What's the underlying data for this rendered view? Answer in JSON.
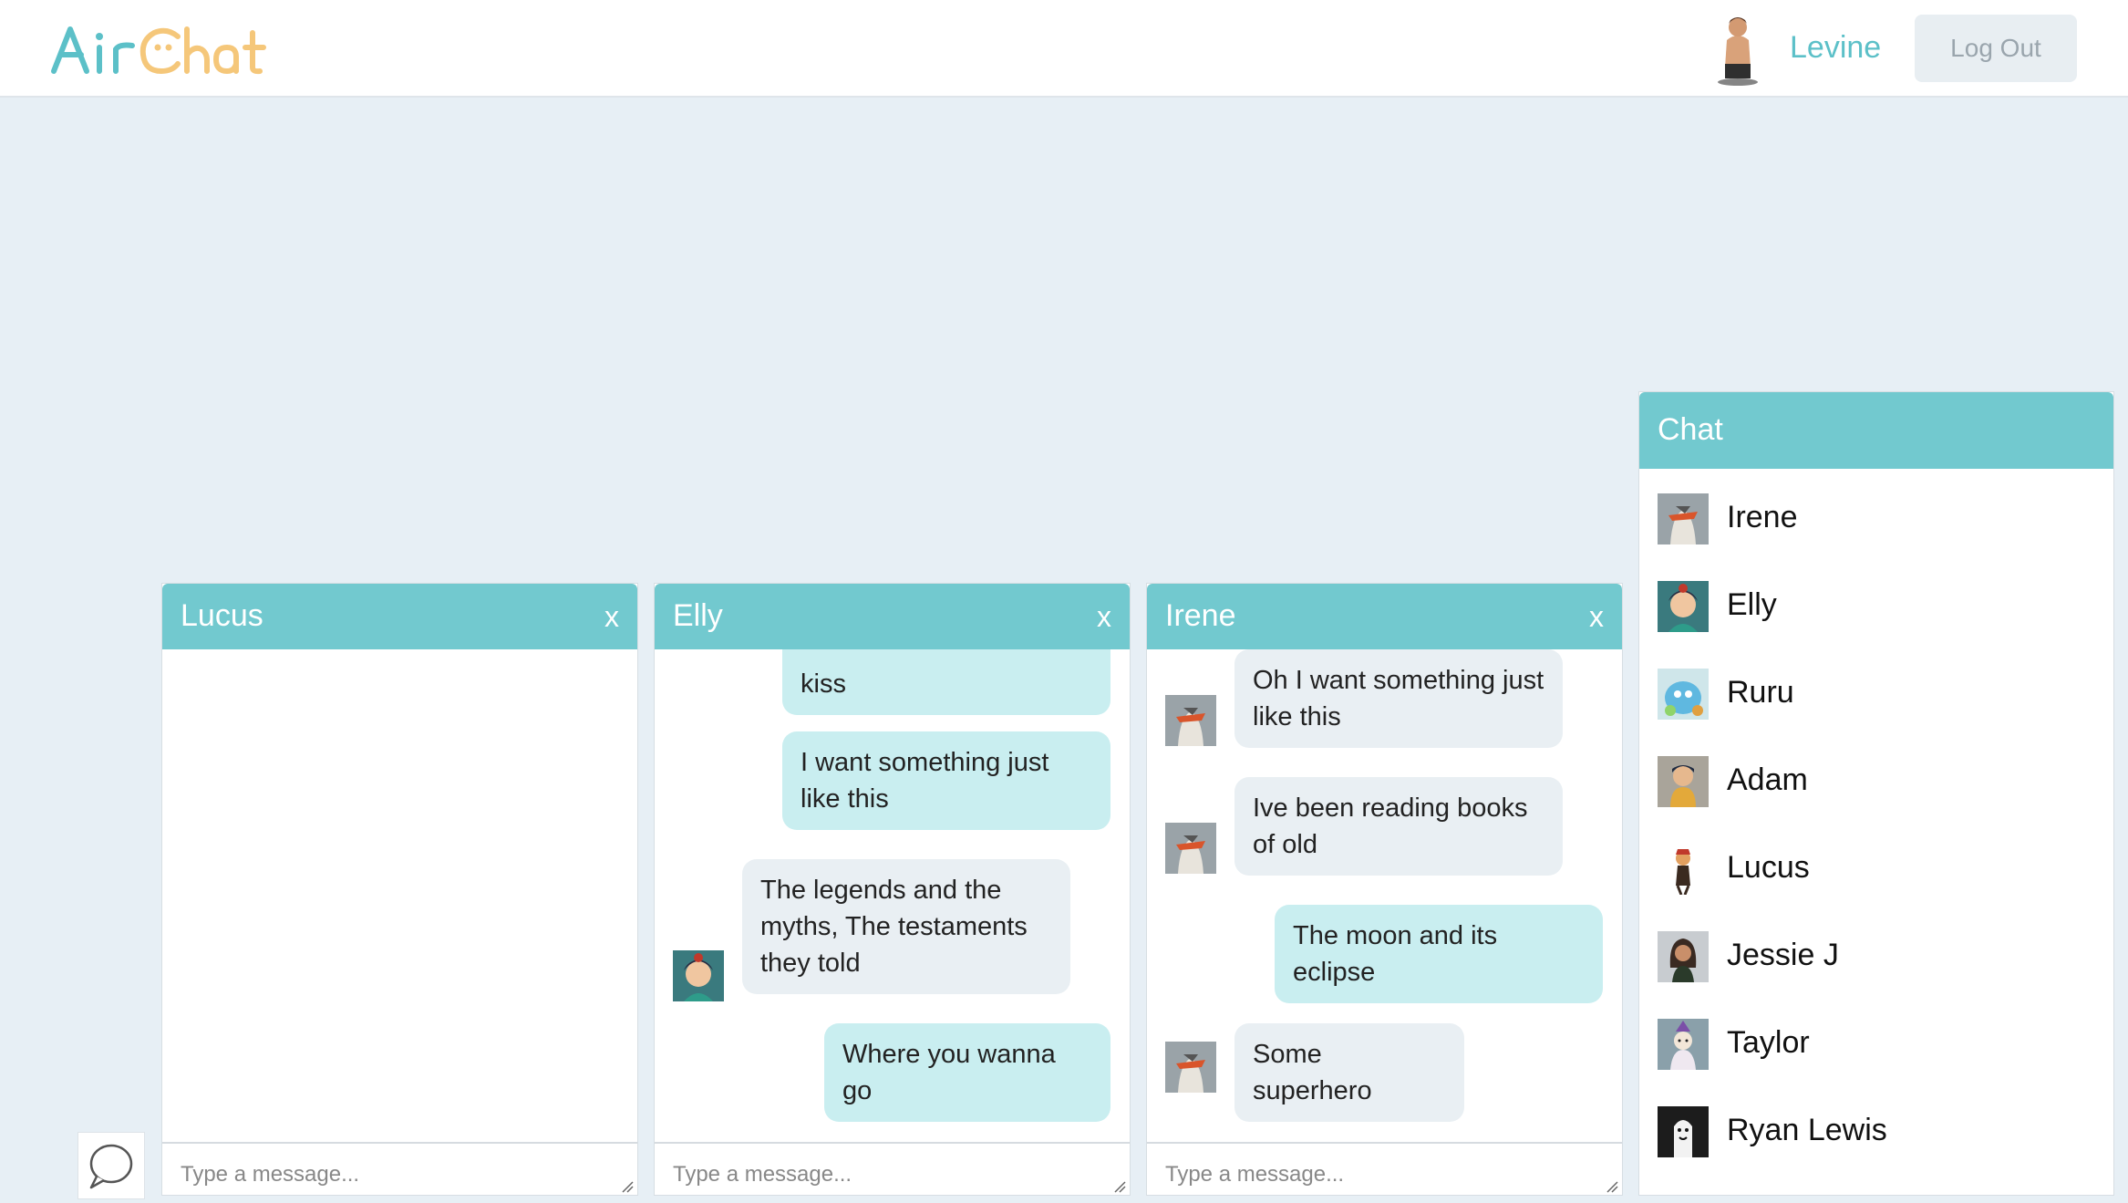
{
  "header": {
    "logo_text": "AirChat",
    "user_name": "Levine",
    "logout_label": "Log Out"
  },
  "colors": {
    "accent": "#72c9cf",
    "logo_teal": "#5cc0c8",
    "logo_yellow": "#f5c77a",
    "bubble_out": "#c9eef0",
    "bubble_in": "#e9eff3",
    "background": "#e7eff5"
  },
  "chat_windows": [
    {
      "title": "Lucus",
      "close_label": "x",
      "placeholder": "Type a message...",
      "messages": []
    },
    {
      "title": "Elly",
      "close_label": "x",
      "placeholder": "Type a message...",
      "messages": [
        {
          "text": "kiss",
          "direction": "out"
        },
        {
          "text": "I want something just like this",
          "direction": "out"
        },
        {
          "text": "The legends and the myths, The testaments they told",
          "direction": "in"
        },
        {
          "text": "Where you wanna go",
          "direction": "out"
        }
      ]
    },
    {
      "title": "Irene",
      "close_label": "x",
      "placeholder": "Type a message...",
      "messages": [
        {
          "text": "Oh I want something just like this",
          "direction": "in"
        },
        {
          "text": "Ive been reading books of old",
          "direction": "in"
        },
        {
          "text": "The moon and its eclipse",
          "direction": "out"
        },
        {
          "text": "Some superhero",
          "direction": "in"
        }
      ]
    }
  ],
  "contacts_panel": {
    "title": "Chat",
    "contacts": [
      {
        "name": "Irene"
      },
      {
        "name": "Elly"
      },
      {
        "name": "Ruru"
      },
      {
        "name": "Adam"
      },
      {
        "name": "Lucus"
      },
      {
        "name": "Jessie J"
      },
      {
        "name": "Taylor"
      },
      {
        "name": "Ryan Lewis"
      }
    ]
  }
}
